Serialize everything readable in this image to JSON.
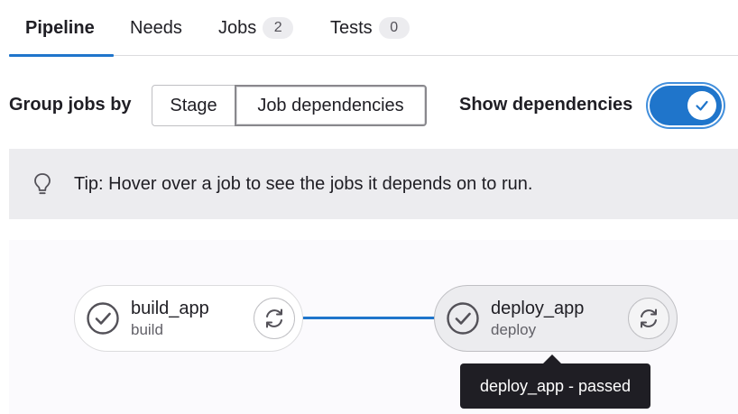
{
  "tabs": [
    {
      "label": "Pipeline",
      "active": true
    },
    {
      "label": "Needs"
    },
    {
      "label": "Jobs",
      "count": "2"
    },
    {
      "label": "Tests",
      "count": "0"
    }
  ],
  "group_by": {
    "label": "Group jobs by",
    "options": [
      "Stage",
      "Job dependencies"
    ],
    "selected": "Job dependencies"
  },
  "show_dependencies": {
    "label": "Show dependencies",
    "enabled": true
  },
  "tip": {
    "icon": "lightbulb-icon",
    "text": "Tip: Hover over a job to see the jobs it depends on to run."
  },
  "jobs": [
    {
      "name": "build_app",
      "stage": "build",
      "status_icon": "check-circle-icon",
      "action_icon": "retry-icon"
    },
    {
      "name": "deploy_app",
      "stage": "deploy",
      "status_icon": "check-circle-icon",
      "action_icon": "retry-icon"
    }
  ],
  "tooltip": {
    "text": "deploy_app - passed"
  },
  "colors": {
    "accent": "#1f75cb",
    "text": "#1f1e24",
    "muted": "#626168",
    "tip_bg": "#ececef"
  }
}
